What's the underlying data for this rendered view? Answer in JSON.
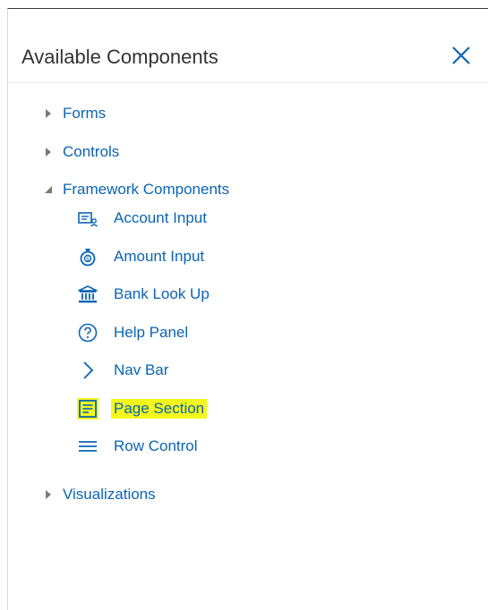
{
  "panel": {
    "title": "Available Components",
    "close_icon": "close-icon"
  },
  "tree": {
    "nodes": [
      {
        "label": "Forms",
        "state": "collapsed"
      },
      {
        "label": "Controls",
        "state": "collapsed"
      },
      {
        "label": "Framework Components",
        "state": "expanded",
        "children": [
          {
            "label": "Account Input",
            "icon": "account-input-icon"
          },
          {
            "label": "Amount Input",
            "icon": "amount-input-icon"
          },
          {
            "label": "Bank Look Up",
            "icon": "bank-icon"
          },
          {
            "label": "Help Panel",
            "icon": "help-icon"
          },
          {
            "label": "Nav Bar",
            "icon": "chevron-right-icon"
          },
          {
            "label": "Page Section",
            "icon": "page-section-icon",
            "highlighted": true
          },
          {
            "label": "Row Control",
            "icon": "row-control-icon"
          }
        ]
      },
      {
        "label": "Visualizations",
        "state": "collapsed"
      }
    ]
  },
  "colors": {
    "accent": "#0a64b4",
    "highlight": "#f3f81a",
    "title_text": "#333333"
  }
}
